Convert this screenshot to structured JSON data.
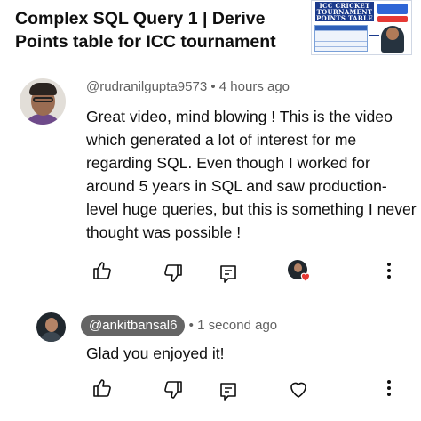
{
  "video": {
    "title": "Complex SQL Query 1 | Derive Points table for ICC tournament",
    "thumbnail_text": "ICC CRICKET TOURNAMENT POINTS TABLE"
  },
  "comment": {
    "author": "@rudranilgupta9573",
    "separator": "•",
    "time": "4 hours ago",
    "text": "Great video, mind blowing ! This is the video which generated a lot of interest for me regarding SQL. Even though I worked for around 5 years in SQL and saw production-level huge queries, but this is something I never thought was possible !",
    "actions": [
      "thumb-up-icon",
      "thumb-down-icon",
      "reply-icon",
      "creator-heart",
      "more-vert-icon"
    ]
  },
  "reply": {
    "author": "@ankitbansal6",
    "separator": "•",
    "time": "1 second ago",
    "text": "Glad you enjoyed it!",
    "actions": [
      "thumb-up-icon",
      "thumb-down-icon",
      "reply-icon",
      "heart-outline-icon",
      "more-vert-icon"
    ]
  },
  "colors": {
    "text": "#0f0f0f",
    "meta": "#606060",
    "author_pill": "#656565",
    "heart": "#e53935"
  }
}
